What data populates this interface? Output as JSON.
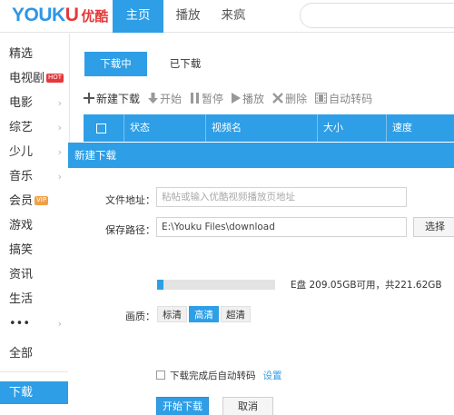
{
  "header": {
    "logo_text_blue": "YOUK",
    "logo_text_red": "U",
    "logo_cn": "优酷",
    "nav": [
      {
        "label": "主页",
        "active": true
      },
      {
        "label": "播放",
        "active": false
      },
      {
        "label": "来疯",
        "active": false
      }
    ]
  },
  "sidebar": {
    "items": [
      {
        "label": "精选"
      },
      {
        "label": "电视剧",
        "badge": "HOT"
      },
      {
        "label": "电影"
      },
      {
        "label": "综艺"
      },
      {
        "label": "少儿"
      },
      {
        "label": "音乐"
      },
      {
        "label": "会员",
        "badge": "VIP"
      },
      {
        "label": "游戏"
      },
      {
        "label": "搞笑"
      },
      {
        "label": "资讯"
      },
      {
        "label": "生活"
      },
      {
        "label": "•••"
      },
      {
        "label": "全部"
      },
      {
        "label": "下载",
        "active": true
      }
    ]
  },
  "download": {
    "tabs": [
      {
        "label": "下载中",
        "active": true
      },
      {
        "label": "已下载",
        "active": false
      }
    ],
    "toolbar": [
      {
        "label": "新建下载",
        "icon": "plus-icon"
      },
      {
        "label": "开始",
        "icon": "download-icon"
      },
      {
        "label": "暂停",
        "icon": "pause-icon"
      },
      {
        "label": "播放",
        "icon": "play-icon"
      },
      {
        "label": "删除",
        "icon": "delete-icon"
      },
      {
        "label": "自动转码",
        "icon": "film-icon"
      }
    ],
    "columns": [
      "状态",
      "视频名",
      "大小",
      "速度"
    ]
  },
  "dialog": {
    "title": "新建下载",
    "file_address_label": "文件地址：",
    "file_address_placeholder": "粘帖或输入优酷视频播放页地址",
    "save_path_label": "保存路径：",
    "save_path_value": "E:\\Youku Files\\download",
    "choose_button": "选择",
    "disk_used_fraction": 0.055,
    "disk_text": "E盘  209.05GB可用，共221.62GB",
    "quality_label": "画质：",
    "quality_options": [
      {
        "label": "标清",
        "active": false
      },
      {
        "label": "高清",
        "active": true
      },
      {
        "label": "超清",
        "active": false
      }
    ],
    "auto_transcode_label": "下载完成后自动转码",
    "settings_link": "设置",
    "start_button": "开始下载",
    "cancel_button": "取消"
  },
  "colors": {
    "accent": "#2e9ee6",
    "logo_red": "#e4393c",
    "hot_badge": "#e4393c",
    "vip_badge": "#f0a04a"
  }
}
